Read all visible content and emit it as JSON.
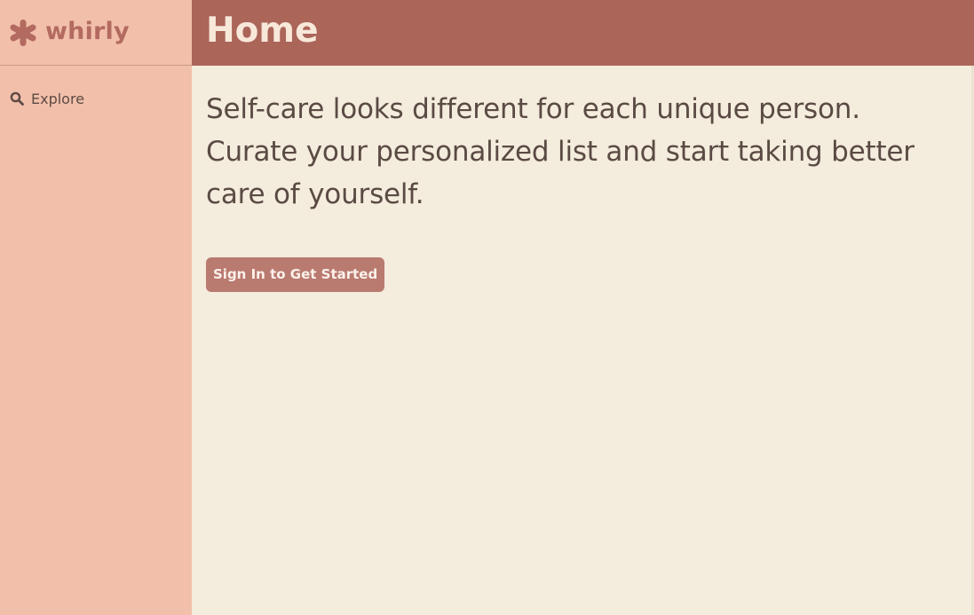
{
  "brand": {
    "name": "whirly",
    "icon": "asterisk-logo-icon",
    "color": "#b36a60"
  },
  "sidebar": {
    "background": "#f2c0aa",
    "items": [
      {
        "label": "Explore",
        "icon": "search-icon"
      }
    ]
  },
  "header": {
    "title": "Home",
    "background": "#ac6559"
  },
  "main": {
    "intro_text": "Self-care looks different for each unique person. Curate your personalized list and start taking better care of yourself.",
    "cta_label": "Sign In to Get Started",
    "background": "#f4ecdc",
    "cta_color": "#b97a70"
  }
}
